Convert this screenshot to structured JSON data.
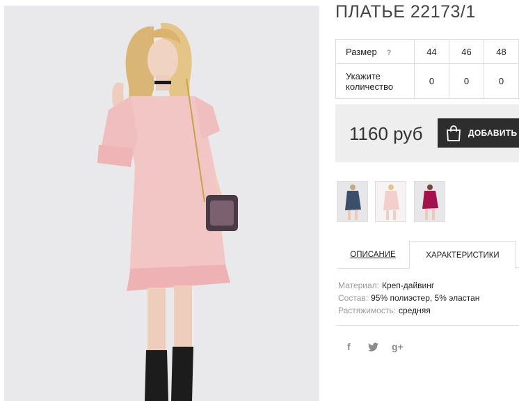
{
  "product": {
    "title": "ПЛАТЬЕ 22173/1",
    "photo_name": "pink-dress-photo"
  },
  "size_table": {
    "size_label": "Размер",
    "help_icon": "?",
    "sizes": [
      "44",
      "46",
      "48"
    ],
    "qty_label": "Укажите количество",
    "quantities": [
      "0",
      "0",
      "0"
    ]
  },
  "purchase": {
    "price": "1160 руб",
    "add_label": "ДОБАВИТЬ",
    "bag_icon": "shopping-bag-icon"
  },
  "thumbnails": [
    {
      "name": "thumb-navy-dress",
      "color": "#3c4f6a"
    },
    {
      "name": "thumb-pink-dress",
      "color": "#f2cfcc"
    },
    {
      "name": "thumb-magenta-dress",
      "color": "#a3124f"
    }
  ],
  "tabs": {
    "description": "ОПИСАНИЕ",
    "characteristics": "ХАРАКТЕРИСТИКИ"
  },
  "specs": [
    {
      "label": "Материал:",
      "value": "Креп-дайвинг"
    },
    {
      "label": "Состав:",
      "value": "95% полиэстер, 5% эластан"
    },
    {
      "label": "Растяжимость:",
      "value": "средняя"
    }
  ],
  "social": {
    "facebook": "f",
    "twitter": "twitter-bird-icon",
    "googleplus": "g+"
  },
  "colors": {
    "dress_pink": "#f3c6c6",
    "button_dark": "#2d2d2d",
    "buy_box_bg": "#eeeeee"
  }
}
